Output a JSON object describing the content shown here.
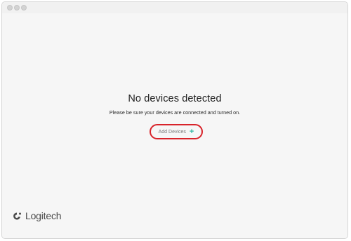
{
  "window": {
    "controls": [
      "close",
      "minimize",
      "zoom"
    ]
  },
  "main": {
    "title": "No devices detected",
    "message": "Please be sure your devices are connected and turned on.",
    "add_button_label": "Add Devices",
    "add_button_icon": "plus-icon",
    "highlight_color": "#d8232a",
    "accent_color": "#2bb3a0"
  },
  "footer": {
    "brand": "Logitech"
  }
}
